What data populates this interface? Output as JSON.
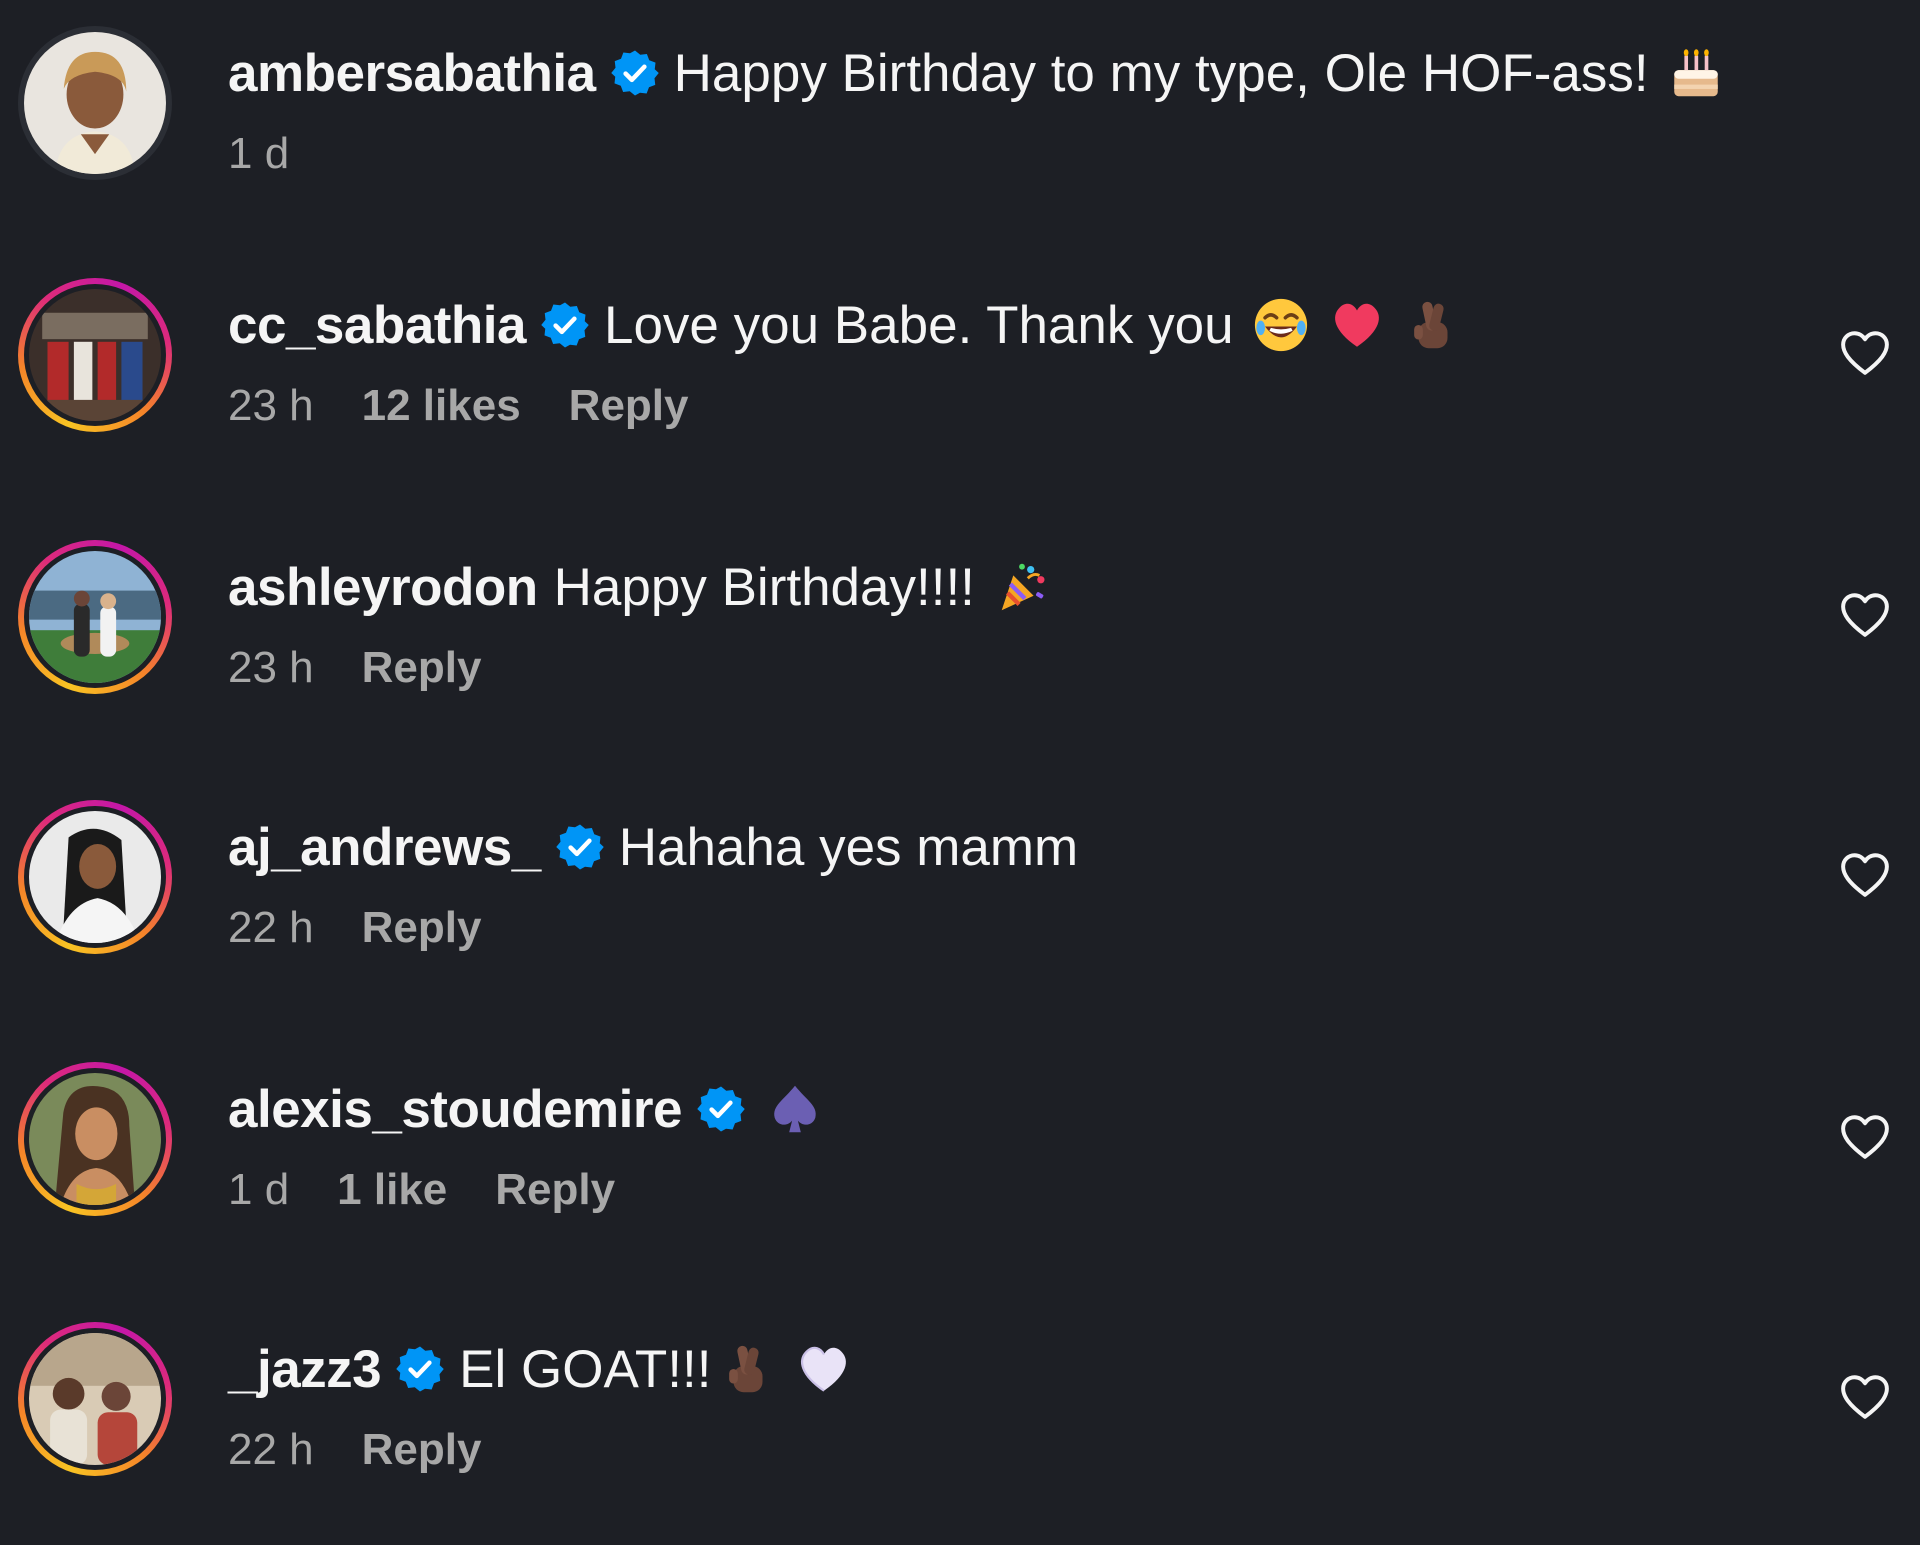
{
  "colors": {
    "background": "#1d1f25",
    "text_primary": "#f5f5f5",
    "text_secondary": "#a8a8a8",
    "verified_blue": "#0095f6",
    "story_ring": [
      "#f9c423",
      "#f58529",
      "#dd2a7b",
      "#c417a8"
    ]
  },
  "comments": [
    {
      "username": "ambersabathia",
      "verified": true,
      "text": "Happy Birthday to my type, Ole HOF-ass!",
      "emojis": [
        "birthday-cake-icon"
      ],
      "time": "1 d",
      "likes": "",
      "reply": "",
      "has_like_button": false,
      "story_ring": false
    },
    {
      "username": "cc_sabathia",
      "verified": true,
      "text": "Love you Babe. Thank you",
      "emojis": [
        "face-with-tears-of-joy-icon",
        "red-heart-icon",
        "crossed-fingers-icon"
      ],
      "time": "23 h",
      "likes": "12 likes",
      "reply": "Reply",
      "has_like_button": true,
      "story_ring": true
    },
    {
      "username": "ashleyrodon",
      "verified": false,
      "text": "Happy Birthday!!!!",
      "emojis": [
        "party-popper-icon"
      ],
      "time": "23 h",
      "likes": "",
      "reply": "Reply",
      "has_like_button": true,
      "story_ring": true
    },
    {
      "username": "aj_andrews_",
      "verified": true,
      "text": "Hahaha yes mamm",
      "emojis": [],
      "time": "22 h",
      "likes": "",
      "reply": "Reply",
      "has_like_button": true,
      "story_ring": true
    },
    {
      "username": "alexis_stoudemire",
      "verified": true,
      "text": "",
      "emojis": [
        "spade-suit-icon"
      ],
      "time": "1 d",
      "likes": "1 like",
      "reply": "Reply",
      "has_like_button": true,
      "story_ring": true
    },
    {
      "username": "_jazz3",
      "verified": true,
      "text": "El GOAT!!!",
      "emojis": [
        "crossed-fingers-icon",
        "white-heart-icon"
      ],
      "time": "22 h",
      "likes": "",
      "reply": "Reply",
      "has_like_button": true,
      "story_ring": true
    }
  ]
}
